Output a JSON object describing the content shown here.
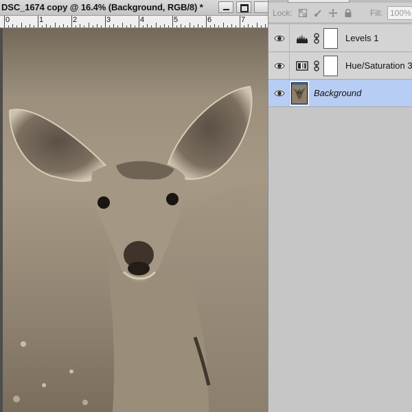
{
  "document": {
    "title": "DSC_1674 copy @ 16.4% (Background, RGB/8) *"
  },
  "ruler": {
    "marks": [
      "0",
      "1",
      "2",
      "3",
      "4",
      "5",
      "6",
      "7"
    ]
  },
  "layers_panel": {
    "lock_label": "Lock:",
    "fill_label": "Fill:",
    "fill_value": "100%",
    "layers": [
      {
        "name": "Levels 1",
        "type": "adjustment",
        "icon": "levels-icon",
        "visible": true,
        "selected": false
      },
      {
        "name": "Hue/Saturation 3",
        "type": "adjustment",
        "icon": "hue-saturation-icon",
        "visible": true,
        "selected": false
      },
      {
        "name": "Background",
        "type": "image",
        "icon": "photo-thumbnail",
        "visible": true,
        "selected": true
      }
    ]
  },
  "colors": {
    "selection": "#b8cdf3",
    "panel": "#c6c6c6",
    "sepia_mid": "#8a7d6b"
  }
}
